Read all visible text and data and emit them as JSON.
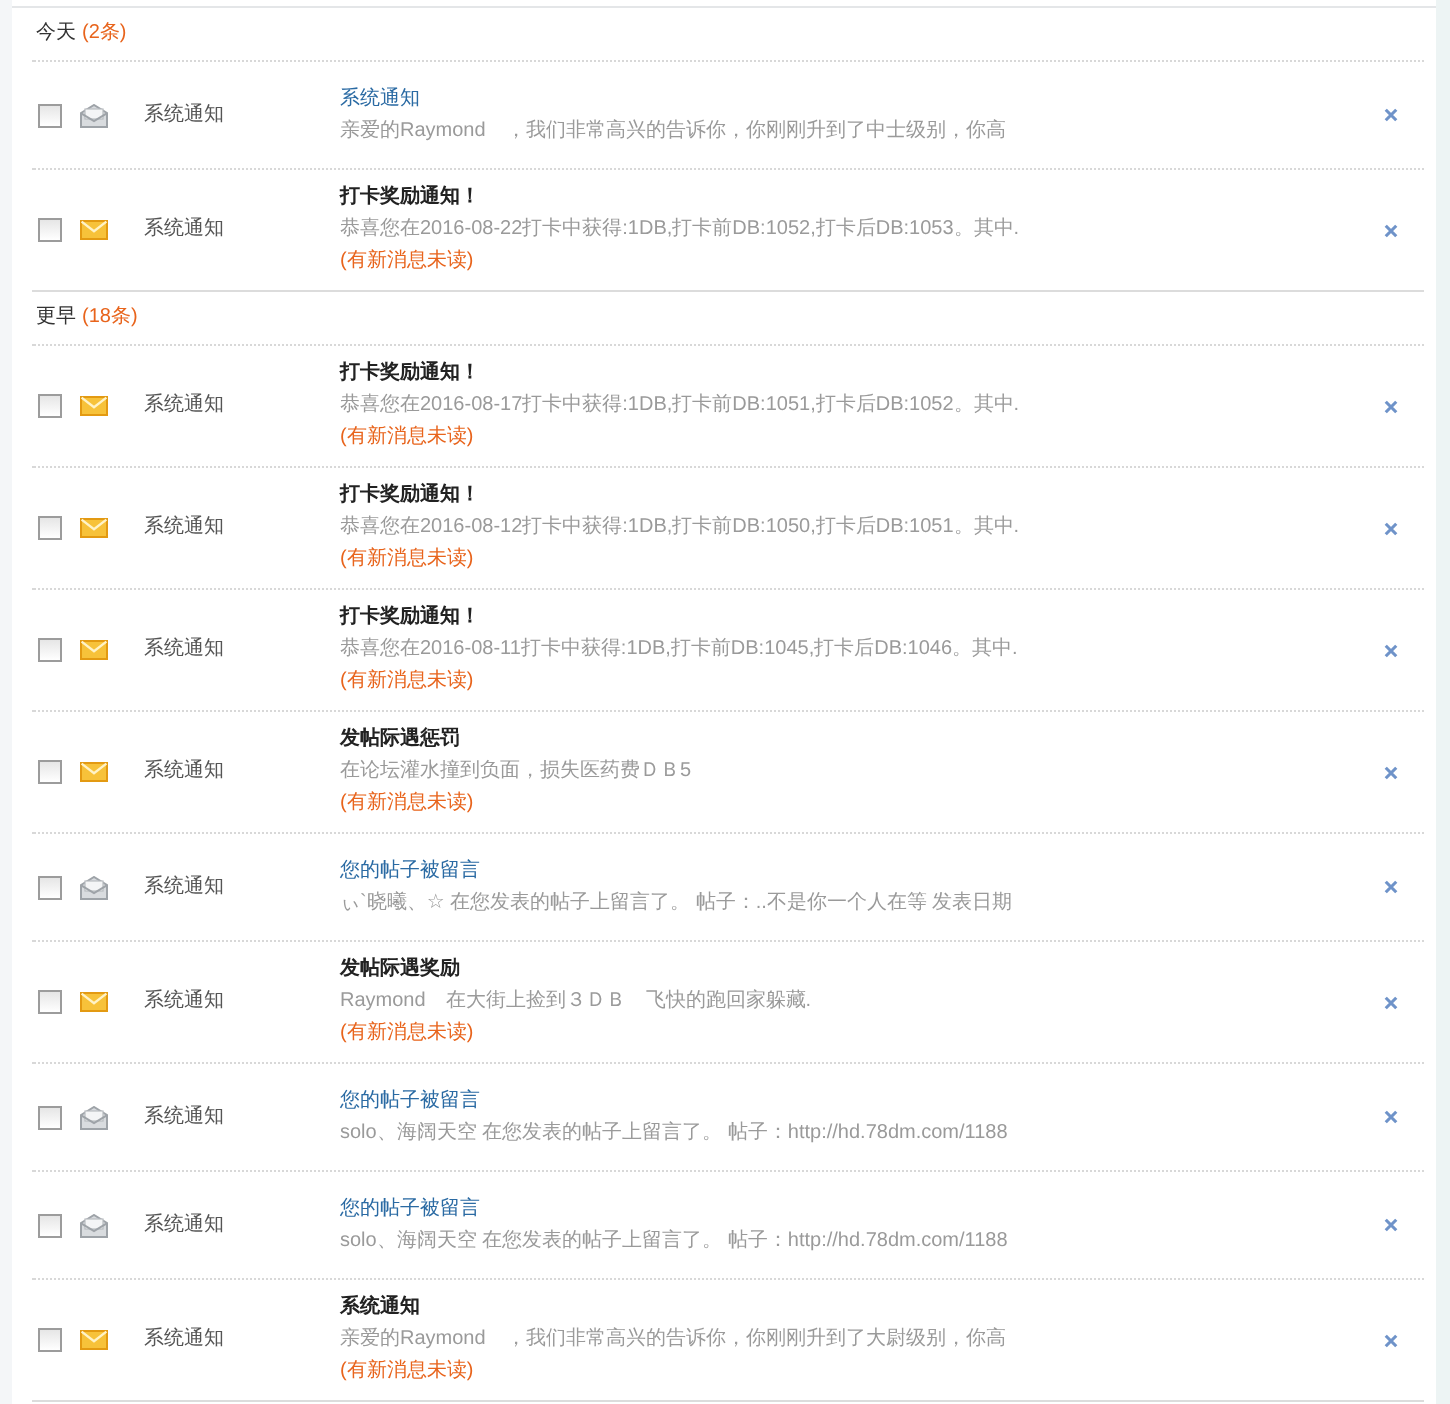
{
  "sections": [
    {
      "label": "今天",
      "count": "(2条)",
      "items": [
        {
          "checked": false,
          "unread": false,
          "type": "系统通知",
          "title": "系统通知",
          "body": "亲爱的Raymond　，我们非常高兴的告诉你，你刚刚升到了中士级别，你高"
        },
        {
          "checked": false,
          "unread": true,
          "type": "系统通知",
          "title": "打卡奖励通知！",
          "body": "恭喜您在2016-08-22打卡中获得:1DB,打卡前DB:1052,打卡后DB:1053。其中.",
          "notice": "(有新消息未读)"
        }
      ]
    },
    {
      "label": "更早",
      "count": "(18条)",
      "items": [
        {
          "checked": false,
          "unread": true,
          "type": "系统通知",
          "title": "打卡奖励通知！",
          "body": "恭喜您在2016-08-17打卡中获得:1DB,打卡前DB:1051,打卡后DB:1052。其中.",
          "notice": "(有新消息未读)"
        },
        {
          "checked": false,
          "unread": true,
          "type": "系统通知",
          "title": "打卡奖励通知！",
          "body": "恭喜您在2016-08-12打卡中获得:1DB,打卡前DB:1050,打卡后DB:1051。其中.",
          "notice": "(有新消息未读)"
        },
        {
          "checked": false,
          "unread": true,
          "type": "系统通知",
          "title": "打卡奖励通知！",
          "body": "恭喜您在2016-08-11打卡中获得:1DB,打卡前DB:1045,打卡后DB:1046。其中.",
          "notice": "(有新消息未读)"
        },
        {
          "checked": false,
          "unread": true,
          "type": "系统通知",
          "title": "发帖际遇惩罚",
          "body": "在论坛灌水撞到负面，损失医药费ＤＢ5",
          "notice": "(有新消息未读)"
        },
        {
          "checked": false,
          "unread": false,
          "type": "系统通知",
          "title": "您的帖子被留言",
          "body": "ぃ`晓曦、☆ 在您发表的帖子上留言了。 帖子：..不是你一个人在等 发表日期"
        },
        {
          "checked": false,
          "unread": true,
          "type": "系统通知",
          "title": "发帖际遇奖励",
          "body": "Raymond　在大街上捡到３ＤＢ　飞快的跑回家躲藏.",
          "notice": "(有新消息未读)"
        },
        {
          "checked": false,
          "unread": false,
          "type": "系统通知",
          "title": "您的帖子被留言",
          "body": "solo、海阔天空 在您发表的帖子上留言了。 帖子：http://hd.78dm.com/1188"
        },
        {
          "checked": false,
          "unread": false,
          "type": "系统通知",
          "title": "您的帖子被留言",
          "body": "solo、海阔天空 在您发表的帖子上留言了。 帖子：http://hd.78dm.com/1188"
        },
        {
          "checked": false,
          "unread": true,
          "type": "系统通知",
          "title": "系统通知",
          "body": "亲爱的Raymond　，我们非常高兴的告诉你，你刚刚升到了大尉级别，你高",
          "notice": "(有新消息未读)"
        }
      ]
    }
  ]
}
